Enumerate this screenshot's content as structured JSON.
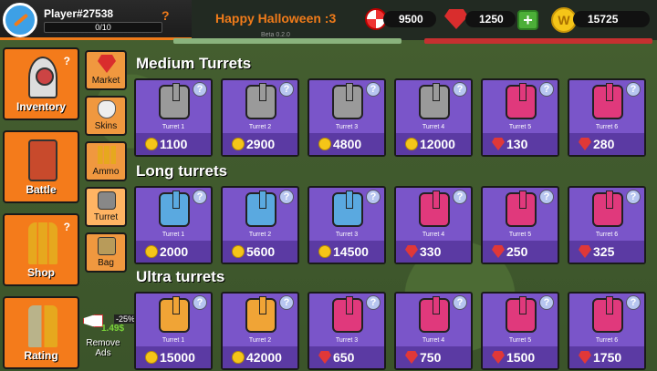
{
  "player": {
    "name": "Player#27538",
    "xp": "0/10",
    "quest_mark": "?"
  },
  "event_title": "Happy Halloween :3",
  "version": "Beta 0.2.0",
  "currencies": {
    "candy": "9500",
    "gems": "1250",
    "coins": "15725",
    "add_label": "+",
    "coin_symbol": "W"
  },
  "nav": [
    {
      "label": "Inventory",
      "icon": "rocket-icon"
    },
    {
      "label": "Battle",
      "icon": "battle-icon"
    },
    {
      "label": "Shop",
      "icon": "bullets-icon"
    },
    {
      "label": "Rating",
      "icon": "rating-icon"
    }
  ],
  "subnav": [
    {
      "label": "Market",
      "icon": "gem-icon"
    },
    {
      "label": "Skins",
      "icon": "mask-icon"
    },
    {
      "label": "Ammo",
      "icon": "bullets-icon"
    },
    {
      "label": "Turret",
      "icon": "turret-icon"
    },
    {
      "label": "Bag",
      "icon": "bag-icon"
    }
  ],
  "remove_ads": {
    "label": "Remove Ads",
    "price": "1.49$",
    "discount": "-25%"
  },
  "sections": [
    {
      "title": "Medium Turrets",
      "items": [
        {
          "name": "Turret 1",
          "price": "1100",
          "currency": "coin",
          "tone": "gray"
        },
        {
          "name": "Turret 2",
          "price": "2900",
          "currency": "coin",
          "tone": "gray"
        },
        {
          "name": "Turret 3",
          "price": "4800",
          "currency": "coin",
          "tone": "gray"
        },
        {
          "name": "Turret 4",
          "price": "12000",
          "currency": "coin",
          "tone": "gray"
        },
        {
          "name": "Turret 5",
          "price": "130",
          "currency": "gem",
          "tone": "pink"
        },
        {
          "name": "Turret 6",
          "price": "280",
          "currency": "gem",
          "tone": "pink"
        }
      ]
    },
    {
      "title": "Long turrets",
      "items": [
        {
          "name": "Turret 1",
          "price": "2000",
          "currency": "coin",
          "tone": "blue"
        },
        {
          "name": "Turret 2",
          "price": "5600",
          "currency": "coin",
          "tone": "blue"
        },
        {
          "name": "Turret 3",
          "price": "14500",
          "currency": "coin",
          "tone": "blue"
        },
        {
          "name": "Turret 4",
          "price": "330",
          "currency": "gem",
          "tone": "pink"
        },
        {
          "name": "Turret 5",
          "price": "250",
          "currency": "gem",
          "tone": "pink"
        },
        {
          "name": "Turret 6",
          "price": "325",
          "currency": "gem",
          "tone": "pink"
        }
      ]
    },
    {
      "title": "Ultra turrets",
      "items": [
        {
          "name": "Turret 1",
          "price": "15000",
          "currency": "coin",
          "tone": "orange"
        },
        {
          "name": "Turret 2",
          "price": "42000",
          "currency": "coin",
          "tone": "orange"
        },
        {
          "name": "Turret 3",
          "price": "650",
          "currency": "gem",
          "tone": "pink"
        },
        {
          "name": "Turret 4",
          "price": "750",
          "currency": "gem",
          "tone": "pink"
        },
        {
          "name": "Turret 5",
          "price": "1500",
          "currency": "gem",
          "tone": "pink"
        },
        {
          "name": "Turret 6",
          "price": "1750",
          "currency": "gem",
          "tone": "pink"
        }
      ]
    }
  ],
  "info_symbol": "?",
  "colors": {
    "accent": "#f47b1b",
    "card": "#7a55c9",
    "card_footer": "#5b3aa3"
  }
}
